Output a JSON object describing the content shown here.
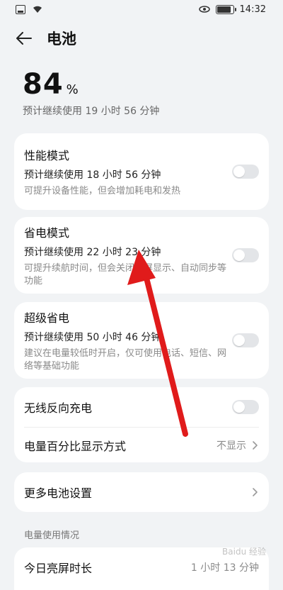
{
  "status": {
    "time": "14:32"
  },
  "header": {
    "title": "电池"
  },
  "summary": {
    "percent": "84",
    "percent_sign": "%",
    "estimate": "预计继续使用 19 小时 56 分钟"
  },
  "cards": {
    "performance": {
      "title": "性能模式",
      "estimate": "预计继续使用 18 小时 56 分钟",
      "desc": "可提升设备性能，但会增加耗电和发热",
      "enabled": false
    },
    "power_saving": {
      "title": "省电模式",
      "estimate": "预计继续使用 22 小时 23 分钟",
      "desc": "可提升续航时间，但会关闭熄屏显示、自动同步等功能",
      "enabled": false
    },
    "super_saving": {
      "title": "超级省电",
      "estimate": "预计继续使用 50 小时 46 分钟",
      "desc": "建议在电量较低时开启，仅可使用电话、短信、网络等基础功能",
      "enabled": false
    },
    "reverse_charge": {
      "title": "无线反向充电",
      "enabled": false
    },
    "percent_display": {
      "title": "电量百分比显示方式",
      "value": "不显示"
    },
    "more_settings": {
      "title": "更多电池设置"
    },
    "usage_section": "电量使用情况",
    "screen_time": {
      "title": "今日亮屏时长",
      "value": "1 小时 13 分钟"
    }
  },
  "colors": {
    "annotation_arrow": "#e01b1b",
    "background": "#f1f3f5"
  },
  "watermark": "Baidu 经验"
}
